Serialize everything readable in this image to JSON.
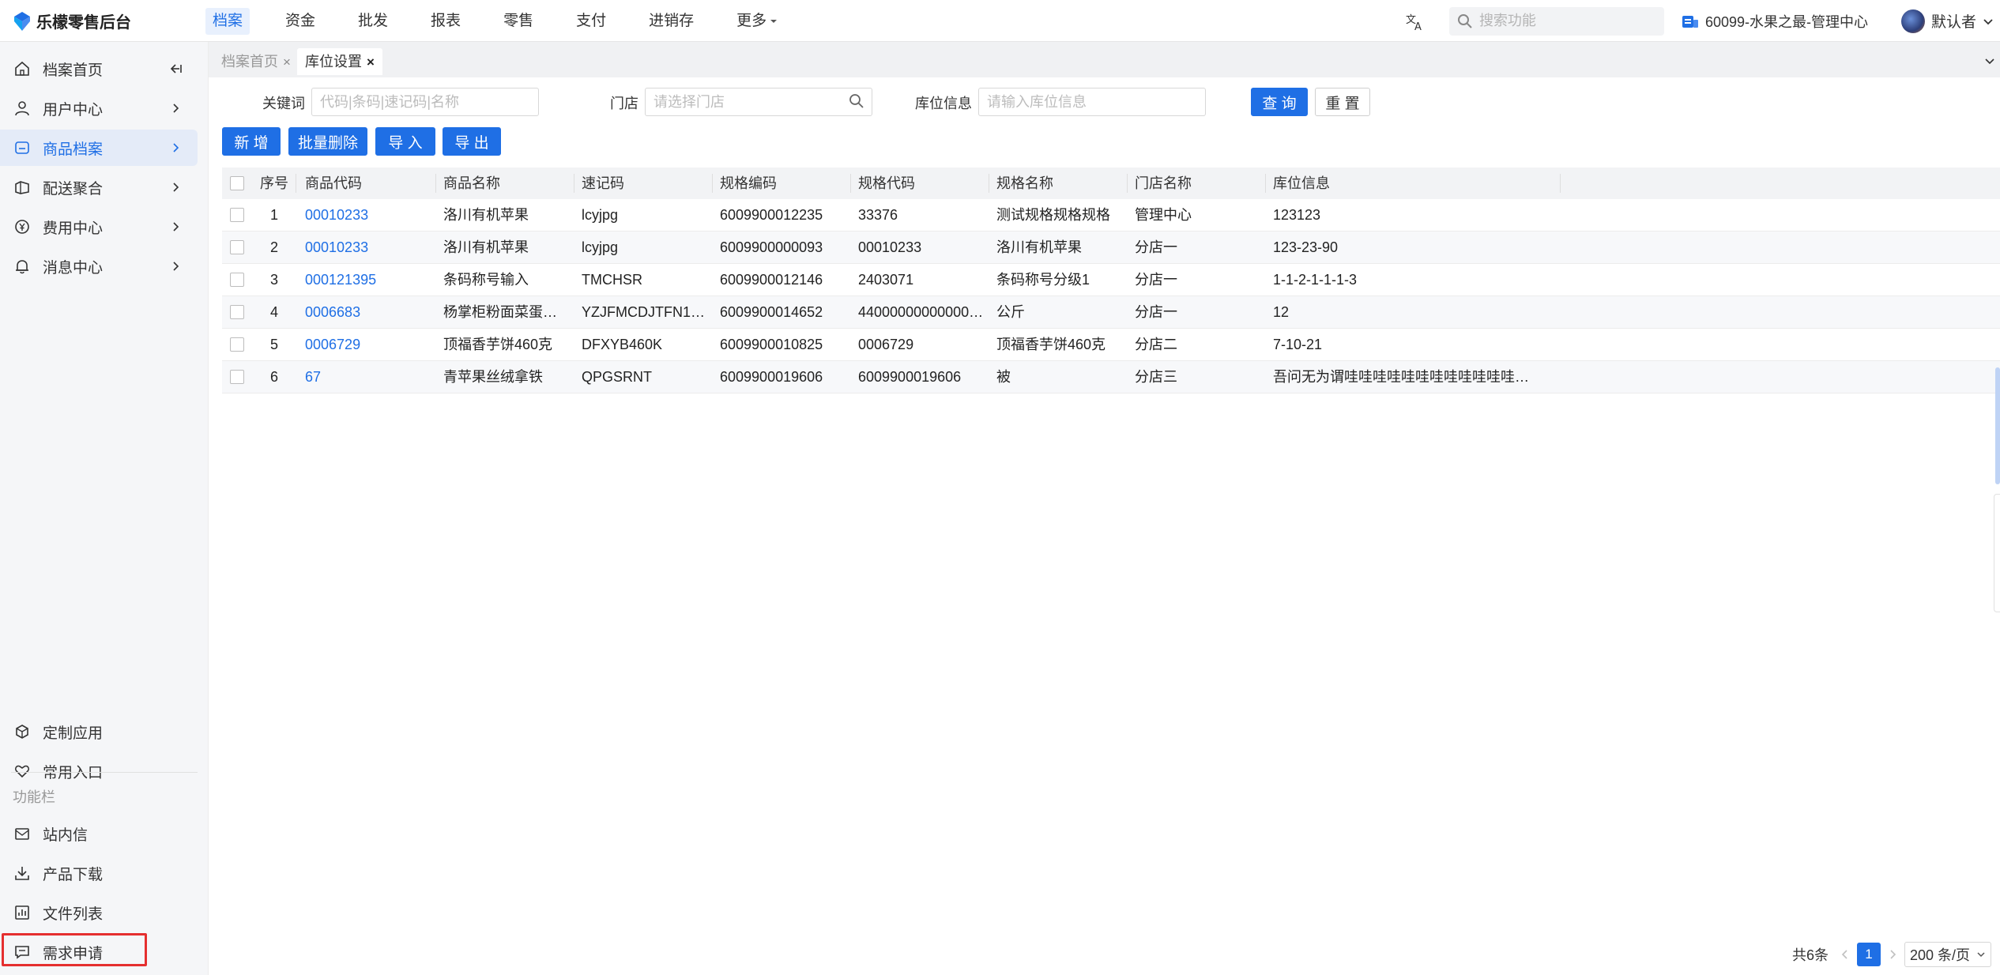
{
  "app": {
    "title": "乐檬零售后台",
    "nav": [
      "档案",
      "资金",
      "批发",
      "报表",
      "零售",
      "支付",
      "进销存",
      "更多"
    ],
    "active_nav": "档案",
    "search_placeholder": "搜索功能",
    "store": "60099-水果之最-管理中心",
    "user": "默认者",
    "accent": "#1f6fe5",
    "highlight_color": "#e52f2f"
  },
  "sidebar": {
    "items": [
      {
        "label": "档案首页",
        "icon": "home-icon"
      },
      {
        "label": "用户中心",
        "icon": "user-icon"
      },
      {
        "label": "商品档案",
        "icon": "product-icon"
      },
      {
        "label": "配送聚合",
        "icon": "delivery-icon"
      },
      {
        "label": "费用中心",
        "icon": "yen-icon"
      },
      {
        "label": "消息中心",
        "icon": "bell-icon"
      }
    ],
    "bottom": [
      {
        "label": "定制应用",
        "icon": "box-icon"
      },
      {
        "label": "常用入口",
        "icon": "heart-icon"
      }
    ],
    "section_title": "功能栏",
    "tools": [
      {
        "label": "站内信",
        "icon": "mail-icon"
      },
      {
        "label": "产品下载",
        "icon": "download-icon"
      },
      {
        "label": "文件列表",
        "icon": "chart-icon"
      },
      {
        "label": "需求申请",
        "icon": "message-icon"
      }
    ]
  },
  "tabs": [
    {
      "label": "档案首页",
      "close": "×"
    },
    {
      "label": "库位设置",
      "close": "×"
    }
  ],
  "filters": {
    "keyword_label": "关键词",
    "keyword_placeholder": "代码|条码|速记码|名称",
    "store_label": "门店",
    "store_placeholder": "请选择门店",
    "location_label": "库位信息",
    "location_placeholder": "请输入库位信息",
    "query": "查 询",
    "reset": "重 置"
  },
  "actions": {
    "add": "新 增",
    "batch_delete": "批量删除",
    "import": "导 入",
    "export": "导 出"
  },
  "table": {
    "columns": [
      "序号",
      "商品代码",
      "商品名称",
      "速记码",
      "规格编码",
      "规格代码",
      "规格名称",
      "门店名称",
      "库位信息"
    ],
    "rows": [
      [
        "1",
        "00010233",
        "洛川有机苹果",
        "lcyjpg",
        "6009900012235",
        "33376",
        "测试规格规格规格",
        "管理中心",
        "123123"
      ],
      [
        "2",
        "00010233",
        "洛川有机苹果",
        "lcyjpg",
        "6009900000093",
        "00010233",
        "洛川有机苹果",
        "分店一",
        "123-23-90"
      ],
      [
        "3",
        "000121395",
        "条码称号输入",
        "TMCHSR",
        "6009900012146",
        "2403071",
        "条码称号分级1",
        "分店一",
        "1-1-2-1-1-1-3"
      ],
      [
        "4",
        "0006683",
        "杨掌柜粉面菜蛋…",
        "YZJFMCDJTFN1…",
        "6009900014652",
        "44000000000000…",
        "公斤",
        "分店一",
        "12"
      ],
      [
        "5",
        "0006729",
        "顶福香芋饼460克",
        "DFXYB460K",
        "6009900010825",
        "0006729",
        "顶福香芋饼460克",
        "分店二",
        "7-10-21"
      ],
      [
        "6",
        "67",
        "青苹果丝绒拿铁",
        "QPGSRNT",
        "6009900019606",
        "6009900019606",
        "被",
        "分店三",
        "吾问无为谓哇哇哇哇哇哇哇哇哇哇哇哇…"
      ]
    ]
  },
  "pagination": {
    "total": "共6条",
    "current": "1",
    "page_size": "200 条/页"
  }
}
